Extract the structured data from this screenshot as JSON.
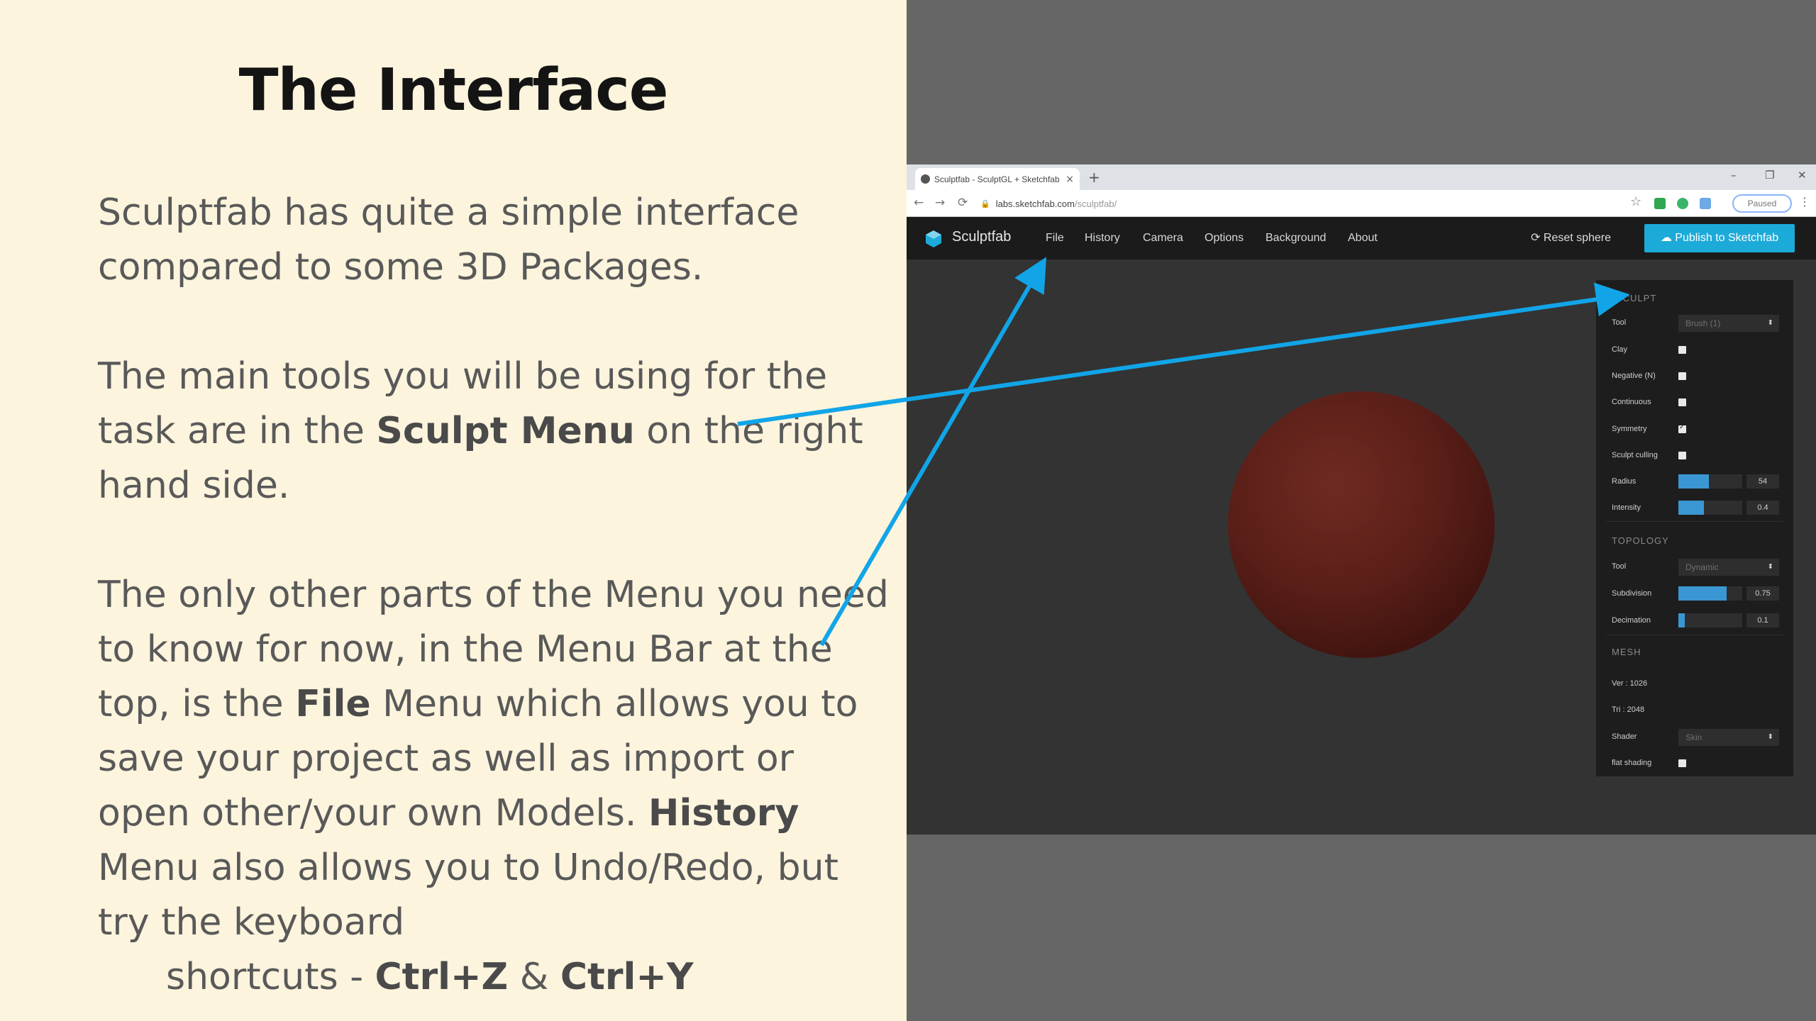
{
  "slide": {
    "title": "The Interface",
    "para1": "Sculptfab has quite a simple interface compared to some 3D Packages.",
    "para2": {
      "pre": "The main tools you will be using for the task are in the ",
      "bold": "Sculpt Menu",
      "post": " on the right hand side."
    },
    "para3": {
      "p1": "The only other parts of the Menu you need to know for now, in the Menu Bar at the top, is the ",
      "b1": "File",
      "p2": " Menu which allows you to save your project as well as import or open other/your own Models. ",
      "b2": "History",
      "p3": " Menu also allows you to Undo/Redo, but try the keyboard"
    },
    "para4": {
      "pre": "shortcuts - ",
      "b1": "Ctrl+Z",
      "mid": " & ",
      "b2": "Ctrl+Y"
    }
  },
  "browser": {
    "tab_title": "Sculptfab - SculptGL + Sketchfab",
    "new_tab": "+",
    "minimize": "–",
    "restore": "❐",
    "close": "✕",
    "url_host": "labs.sketchfab.com",
    "url_path": "/sculptfab/",
    "profile_label": "Paused"
  },
  "app": {
    "name": "Sculptfab",
    "menu": [
      "File",
      "History",
      "Camera",
      "Options",
      "Background",
      "About"
    ],
    "reset_label": "Reset sphere",
    "publish_label": "Publish to Sketchfab",
    "accent": "#1caad9"
  },
  "panel": {
    "sculpt_title": "SCULPT",
    "tool_label": "Tool",
    "tool_value": "Brush (1)",
    "clay": "Clay",
    "negative": "Negative (N)",
    "continuous": "Continuous",
    "symmetry": "Symmetry",
    "sculpt_culling": "Sculpt culling",
    "radius_label": "Radius",
    "radius_value": "54",
    "intensity_label": "Intensity",
    "intensity_value": "0.4",
    "topology_title": "TOPOLOGY",
    "topo_tool_label": "Tool",
    "topo_tool_value": "Dynamic",
    "subdivision_label": "Subdivision",
    "subdivision_value": "0.75",
    "decimation_label": "Decimation",
    "decimation_value": "0.1",
    "mesh_title": "MESH",
    "vertices": "Ver : 1026",
    "triangles": "Tri : 2048",
    "shader_label": "Shader",
    "shader_value": "Skin",
    "flat_shading": "flat shading"
  },
  "annotation_color": "#11a5e8"
}
